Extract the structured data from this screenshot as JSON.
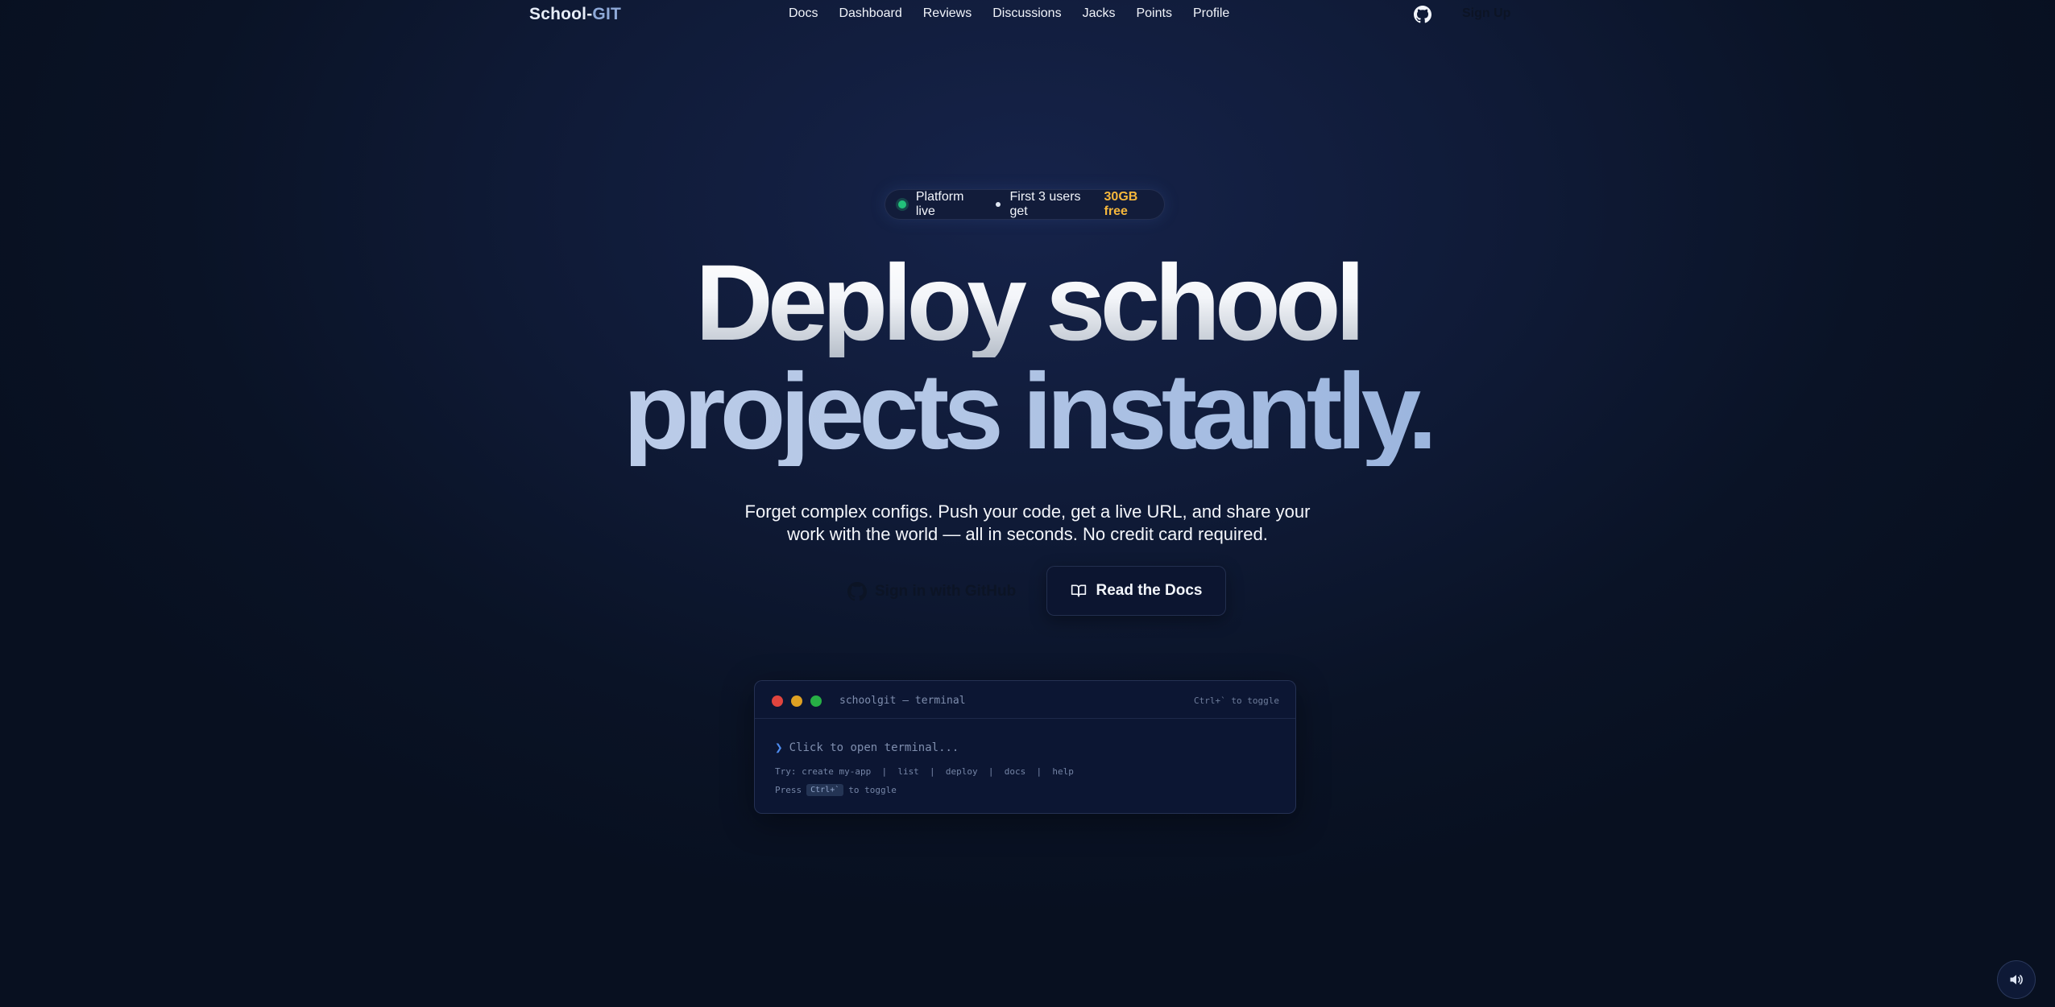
{
  "nav": {
    "brand_main": "School-",
    "brand_accent": "GIT",
    "links": [
      "Docs",
      "Dashboard",
      "Reviews",
      "Discussions",
      "Jacks",
      "Points",
      "Profile"
    ],
    "signup": "Sign Up"
  },
  "badge": {
    "status": "Platform live",
    "offer": "First 3 users get",
    "highlight": "30GB free"
  },
  "hero": {
    "line1": "Deploy school",
    "line2": "projects instantly.",
    "subtitle": "Forget complex configs. Push your code, get a live URL, and share your work with the world — all in seconds. No credit card required."
  },
  "buttons": {
    "github": "Sign in with GitHub",
    "docs": "Read the Docs"
  },
  "terminal": {
    "title": "schoolgit — terminal",
    "toggle_hint": "Ctrl+` to toggle",
    "prompt": "Click to open terminal...",
    "try_line": "Try: create my-app  |  list  |  deploy  |  docs  |  help",
    "press_before": "Press",
    "press_key": "Ctrl+`",
    "press_after": "to toggle"
  },
  "colors": {
    "accent_gold": "#f5b73c",
    "live_green": "#22c07a",
    "background": "#0f1a36"
  },
  "icons": [
    "github-icon",
    "book-icon",
    "chevron-right-icon",
    "speaker-icon"
  ]
}
